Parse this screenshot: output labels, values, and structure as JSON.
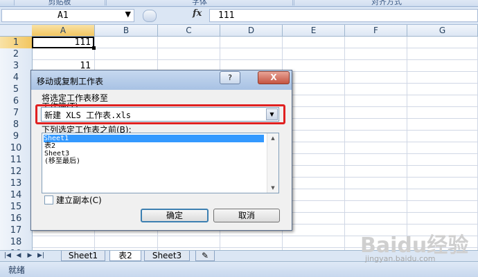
{
  "ribbon": {
    "groups": [
      "剪贴板",
      "字体",
      "对齐方式"
    ]
  },
  "formula_bar": {
    "name_box": "A1",
    "fx": "fx",
    "value": "111"
  },
  "sheet": {
    "columns": [
      "A",
      "B",
      "C",
      "D",
      "E",
      "F",
      "G"
    ],
    "rows": [
      "1",
      "2",
      "3",
      "4",
      "5",
      "6",
      "7",
      "8",
      "9",
      "10",
      "11",
      "12",
      "13",
      "14",
      "15",
      "16",
      "17",
      "18",
      "19"
    ],
    "cells": {
      "A1": "111",
      "A3": "11"
    }
  },
  "sheet_tabs": {
    "nav": [
      "|◀",
      "◀",
      "▶",
      "▶|"
    ],
    "tabs": [
      "Sheet1",
      "表2",
      "Sheet3"
    ],
    "active": "表2"
  },
  "status_bar": {
    "text": "就绪"
  },
  "dialog": {
    "title": "移动或复制工作表",
    "help": "?",
    "close": "X",
    "move_to_label": "将选定工作表移至",
    "workbook_label": "工作簿(T):",
    "workbook_value": "新建 XLS 工作表.xls",
    "before_label": "下列选定工作表之前(B):",
    "sheet_list": [
      "Sheet1",
      "表2",
      "Sheet3",
      "(移至最后)"
    ],
    "selected_index": 0,
    "copy_label": "建立副本(C)",
    "copy_checked": false,
    "ok": "确定",
    "cancel": "取消"
  },
  "watermark": {
    "logo": "Baidu经验",
    "url": "jingyan.baidu.com"
  }
}
